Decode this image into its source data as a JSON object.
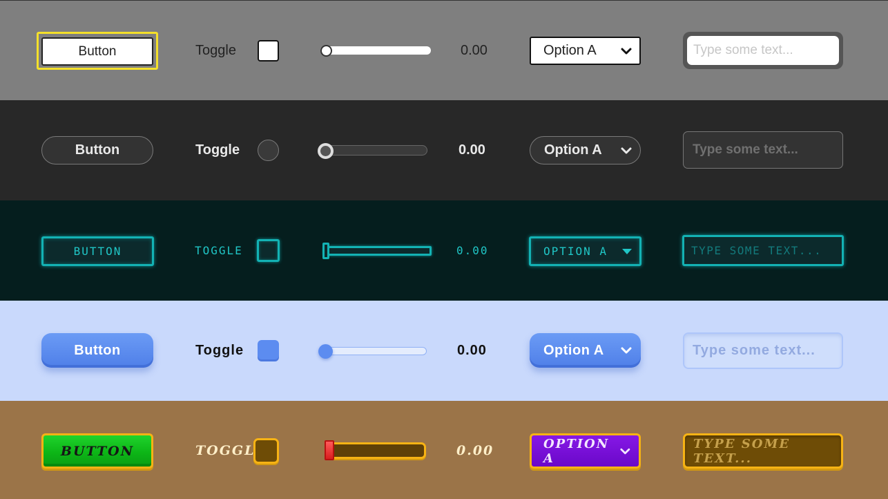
{
  "rows": [
    {
      "theme": "default",
      "background": "#7f7f7f",
      "button_label": "Button",
      "toggle_label": "Toggle",
      "toggle_checked": false,
      "slider_value": 0.0,
      "slider_readout": "0.00",
      "dropdown_selected": "Option A",
      "input_placeholder": "Type some text..."
    },
    {
      "theme": "dark",
      "background": "#282828",
      "button_label": "Button",
      "toggle_label": "Toggle",
      "toggle_checked": false,
      "slider_value": 0.0,
      "slider_readout": "0.00",
      "dropdown_selected": "Option A",
      "input_placeholder": "Type some text..."
    },
    {
      "theme": "teal",
      "background": "#051e1e",
      "accent": "#13b2b4",
      "button_label": "BUTTON",
      "toggle_label": "TOGGLE",
      "toggle_checked": false,
      "slider_value": 0.0,
      "slider_readout": "0.00",
      "dropdown_selected": "OPTION A",
      "input_placeholder": "TYPE SOME TEXT..."
    },
    {
      "theme": "light-blue",
      "background": "#c9d9fc",
      "accent": "#5c8cf0",
      "button_label": "Button",
      "toggle_label": "Toggle",
      "toggle_checked": false,
      "slider_value": 0.0,
      "slider_readout": "0.00",
      "dropdown_selected": "Option A",
      "input_placeholder": "Type some text..."
    },
    {
      "theme": "game",
      "background": "#9b7448",
      "accent": "#f7b314",
      "button_label": "BUTTON",
      "toggle_label": "TOGGLE",
      "toggle_checked": false,
      "slider_value": 0.0,
      "slider_readout": "0.00",
      "dropdown_selected": "OPTION A",
      "input_placeholder": "TYPE SOME TEXT..."
    }
  ],
  "icons": {
    "dropdown": "chevron-down-icon"
  }
}
